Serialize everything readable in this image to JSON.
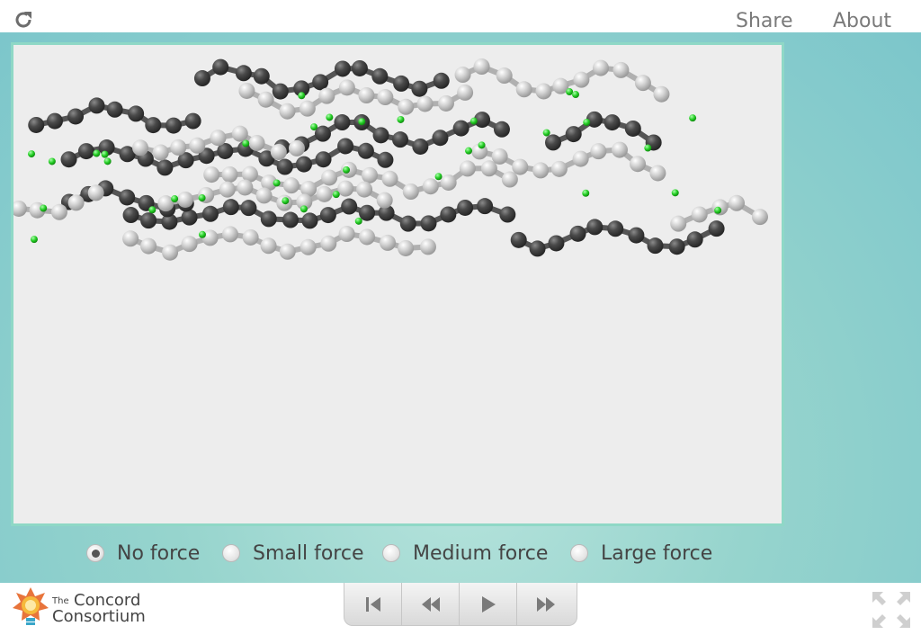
{
  "topbar": {
    "reload_icon": "reload-icon",
    "share_label": "Share",
    "about_label": "About"
  },
  "simulation": {
    "colors": {
      "dark_atom": "#4a4a4a",
      "light_atom": "#c2c2c2",
      "bond_dark": "#555555",
      "bond_light": "#b0b0b0",
      "hydrogen": "#22cc22",
      "frame_border": "#8fd8c6",
      "background": "#ededed"
    }
  },
  "force_options": [
    {
      "label": "No force",
      "checked": true
    },
    {
      "label": "Small force",
      "checked": false
    },
    {
      "label": "Medium force",
      "checked": false
    },
    {
      "label": "Large force",
      "checked": false
    }
  ],
  "footer": {
    "logo_the": "The",
    "logo_concord": "Concord",
    "logo_consortium": "Consortium",
    "playback_icons": [
      "reset-icon",
      "step-back-icon",
      "play-icon",
      "step-forward-icon"
    ],
    "fullscreen_icon": "fullscreen-icon"
  }
}
